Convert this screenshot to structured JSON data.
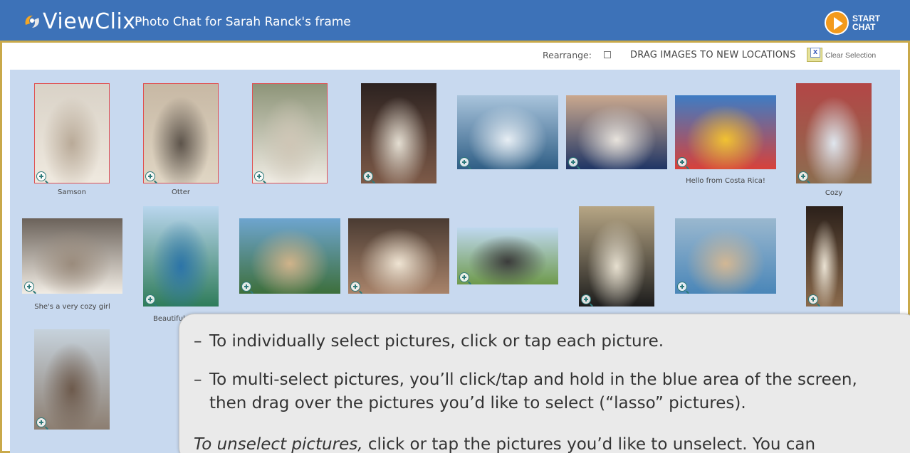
{
  "header": {
    "logo_text": "ViewClix",
    "logo_tm": "™",
    "title": "Photo Chat for Sarah Ranck's frame",
    "start_chat_label": "START CHAT"
  },
  "toolbar": {
    "rearrange_label": "Rearrange:",
    "drag_instruction": "DRAG IMAGES TO NEW LOCATIONS",
    "clear_selection_label": "Clear Selection"
  },
  "photos": [
    {
      "caption": "Samson",
      "selected": true,
      "scene": "baby-sleeping",
      "colors": [
        "#d9d2c7",
        "#efe9df",
        "#b9aa98"
      ]
    },
    {
      "caption": "Otter",
      "selected": true,
      "scene": "cat-on-couch",
      "colors": [
        "#c7b8a4",
        "#e0d6c4",
        "#5d544b"
      ]
    },
    {
      "caption": "",
      "selected": true,
      "scene": "woman-holding-baby",
      "colors": [
        "#8d9478",
        "#f0ece4",
        "#cfc6b6"
      ]
    },
    {
      "caption": "",
      "selected": false,
      "scene": "group-party",
      "colors": [
        "#2c2220",
        "#7d5a48",
        "#e4ded2"
      ]
    },
    {
      "caption": "",
      "selected": false,
      "scene": "ocean-view",
      "colors": [
        "#a9c4dc",
        "#2f5e85",
        "#e7eef4"
      ]
    },
    {
      "caption": "",
      "selected": false,
      "scene": "couple-selfie",
      "colors": [
        "#caa88e",
        "#1f3565",
        "#e8e3dc"
      ]
    },
    {
      "caption": "Hello from Costa Rica!",
      "selected": false,
      "scene": "jaco-sign",
      "colors": [
        "#3e7cc4",
        "#d8413a",
        "#f1c232"
      ]
    },
    {
      "caption": "Cozy",
      "selected": false,
      "scene": "dog-on-sofa",
      "colors": [
        "#b34646",
        "#8c6d4f",
        "#dfe6ee"
      ]
    },
    {
      "caption": "She's a very cozy girl",
      "selected": false,
      "scene": "dog-in-bed",
      "colors": [
        "#6b625a",
        "#f1ece4",
        "#9a8b7c"
      ]
    },
    {
      "caption": "Beautiful Cli",
      "selected": false,
      "scene": "coastal-cliffs",
      "colors": [
        "#b9d6ee",
        "#2f7c5a",
        "#2c74a8"
      ]
    },
    {
      "caption": "",
      "selected": false,
      "scene": "cinque-terre",
      "colors": [
        "#6ea5cf",
        "#3d6f3b",
        "#d0b38a"
      ]
    },
    {
      "caption": "",
      "selected": false,
      "scene": "old-town-window",
      "colors": [
        "#4a3b32",
        "#a8836a",
        "#efe4d3"
      ]
    },
    {
      "caption": "",
      "selected": false,
      "scene": "windmills",
      "colors": [
        "#bfd8ef",
        "#6f9a4c",
        "#3b3b3b"
      ]
    },
    {
      "caption": "",
      "selected": false,
      "scene": "black-dog",
      "colors": [
        "#b7a685",
        "#1c1c1c",
        "#e6dfcf"
      ]
    },
    {
      "caption": "",
      "selected": false,
      "scene": "man-at-table",
      "colors": [
        "#9ab8cf",
        "#4a86b8",
        "#d2b794"
      ]
    },
    {
      "caption": "",
      "selected": false,
      "scene": "wedding-dance",
      "colors": [
        "#2b201a",
        "#8a6a4c",
        "#eae2d3"
      ]
    },
    {
      "caption": "",
      "selected": false,
      "scene": "tower-street",
      "colors": [
        "#c6d2dc",
        "#8c7e71",
        "#6d5a4c"
      ]
    }
  ],
  "tips": {
    "tip1": "To individually select pictures, click or tap each picture.",
    "tip2": "To multi-select pictures, you’ll click/tap and hold in the blue area of the screen, then drag over the pictures you’d like to select (“lasso” pictures).",
    "tip3_em": "To unselect pictures,",
    "tip3_rest": " click or tap the pictures you’d like to unselect.  You can",
    "dash": "–"
  },
  "colors": {
    "header_bg": "#3d72b8",
    "gallery_bg": "#c8d9ef",
    "border_gold": "#c9a94a",
    "start_orange": "#f39a1c",
    "selection_red": "#e05050"
  }
}
